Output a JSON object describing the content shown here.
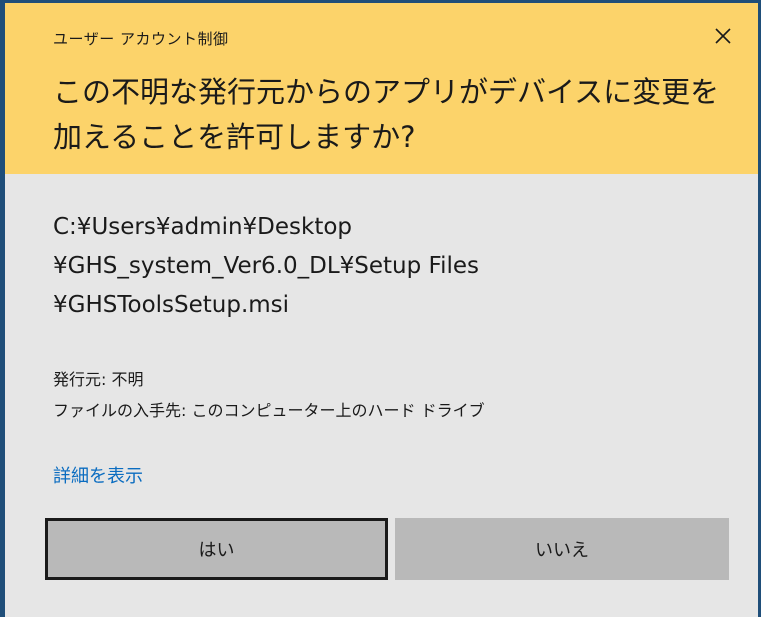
{
  "dialog": {
    "window_title": "ユーザー アカウント制御",
    "close_icon": "close-icon",
    "heading_line1": "この不明な発行元からのアプリがデバイスに変更を",
    "heading_line2": "加えることを許可しますか?",
    "path_line1": "C:¥Users¥admin¥Desktop",
    "path_line2": "¥GHS_system_Ver6.0_DL¥Setup Files",
    "path_line3": "¥GHSToolsSetup.msi",
    "publisher": "発行元: 不明",
    "file_origin": "ファイルの入手先: このコンピューター上のハード ドライブ",
    "details_link": "詳細を表示",
    "yes_button": "はい",
    "no_button": "いいえ"
  },
  "colors": {
    "header_bg": "#fcd36a",
    "body_bg": "#e6e6e6",
    "button_bg": "#b9b9b9",
    "link": "#0a6cc0",
    "frame": "#1f4e79"
  }
}
